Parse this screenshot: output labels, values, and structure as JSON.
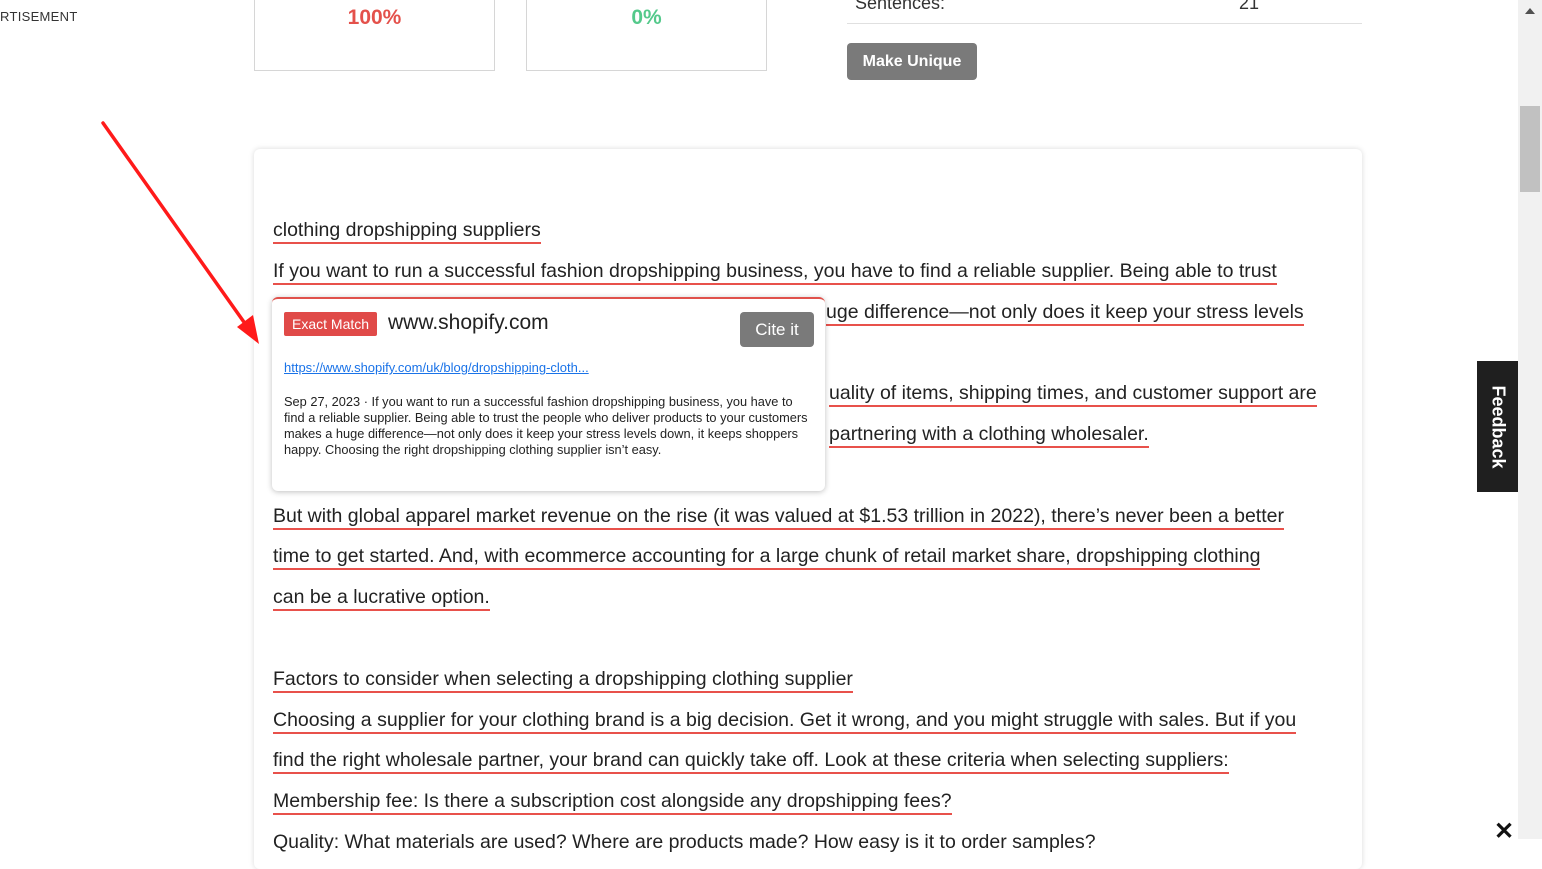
{
  "ad": {
    "label": "RTISEMENT"
  },
  "stats": {
    "plagiarism_percent": "100%",
    "unique_percent": "0%",
    "sentences_label": "Sentences:",
    "sentences_count": "21"
  },
  "actions": {
    "make_unique_label": "Make Unique"
  },
  "content": {
    "paragraphs": [
      "clothing dropshipping suppliers",
      "If you want to run a successful fashion dropshipping business, you have to find a reliable supplier. Being able to trust",
      "uge difference—not only does it keep your stress levels",
      "uality of items, shipping times, and customer support are",
      "partnering with a clothing wholesaler.",
      "But with global apparel market revenue on the rise (it was valued at $1.53 trillion in 2022), there’s never been a better",
      "time to get started. And, with ecommerce accounting for a large chunk of retail market share, dropshipping clothing",
      "can be a lucrative option.",
      "Factors to consider when selecting a dropshipping clothing supplier",
      "Choosing a supplier for your clothing brand is a big decision. Get it wrong, and you might struggle with sales. But if you",
      "find the right wholesale partner, your brand can quickly take off. Look at these criteria when selecting suppliers:",
      "Membership fee: Is there a subscription cost alongside any dropshipping fees?",
      "Quality: What materials are used? Where are products made? How easy is it to order samples?"
    ]
  },
  "popup": {
    "badge": "Exact Match",
    "domain": "www.shopify.com",
    "cite_label": "Cite it",
    "url": "https://www.shopify.com/uk/blog/dropshipping-cloth...",
    "snippet": "Sep 27, 2023 · If you want to run a successful fashion dropshipping business, you have to find a reliable supplier. Being able to trust the people who deliver products to your customers makes a huge difference—not only does it keep your stress levels down, it keeps shoppers happy. Choosing the right dropshipping clothing supplier isn’t easy."
  },
  "feedback": {
    "label": "Feedback"
  },
  "colors": {
    "plagiarism": "#e4514b",
    "unique": "#54c98b",
    "highlight_underline": "#e8514b",
    "badge": "#e04a48",
    "button_gray": "#7a7a7a",
    "arrow": "#ff1a1a"
  },
  "icons": {
    "close": "close-icon",
    "scroll_up": "chevron-up-icon"
  }
}
